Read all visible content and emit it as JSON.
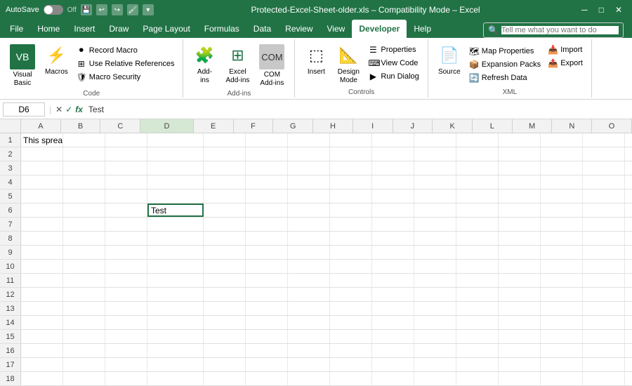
{
  "titleBar": {
    "autosave": "AutoSave",
    "autosaveState": "Off",
    "title": "Protected-Excel-Sheet-older.xls – Compatibility Mode – Excel",
    "icons": [
      "save",
      "undo",
      "redo",
      "format-painter",
      "customize"
    ]
  },
  "ribbonTabs": {
    "tabs": [
      "File",
      "Home",
      "Insert",
      "Draw",
      "Page Layout",
      "Formulas",
      "Data",
      "Review",
      "View",
      "Developer",
      "Help"
    ],
    "activeTab": "Developer"
  },
  "ribbonGroups": {
    "code": {
      "label": "Code",
      "buttons": {
        "visualBasic": "Visual\nBasic",
        "macros": "Macros",
        "recordMacro": "Record Macro",
        "useRelativeRefs": "Use Relative References",
        "macroSecurity": "Macro Security"
      }
    },
    "addIns": {
      "label": "Add-ins",
      "buttons": {
        "addIns": "Add-\nins",
        "excelAddIns": "Excel\nAdd-ins",
        "comAddIns": "COM\nAdd-ins"
      }
    },
    "controls": {
      "label": "Controls",
      "buttons": {
        "insert": "Insert",
        "designMode": "Design\nMode",
        "properties": "Properties",
        "viewCode": "View Code",
        "runDialog": "Run Dialog"
      }
    },
    "xml": {
      "label": "XML",
      "buttons": {
        "source": "Source",
        "mapProperties": "Map Properties",
        "expansionPacks": "Expansion Packs",
        "refreshData": "Refresh Data",
        "import": "Import",
        "export": "Export"
      }
    }
  },
  "search": {
    "placeholder": "Tell me what you want to do"
  },
  "formulaBar": {
    "cellRef": "D6",
    "formula": "Test",
    "fxLabel": "fx"
  },
  "columns": [
    "A",
    "B",
    "C",
    "D",
    "E",
    "F",
    "G",
    "H",
    "I",
    "J",
    "K",
    "L",
    "M",
    "N",
    "O"
  ],
  "rows": [
    1,
    2,
    3,
    4,
    5,
    6,
    7,
    8,
    9,
    10,
    11,
    12,
    13,
    14,
    15,
    16,
    17,
    18
  ],
  "cells": {
    "A1": "This spreadsheet is locked.",
    "D6": "Test"
  },
  "selectedCell": "D6",
  "colors": {
    "excelGreen": "#217346",
    "ribbonBg": "#ffffff",
    "headerBg": "#f2f2f2"
  }
}
